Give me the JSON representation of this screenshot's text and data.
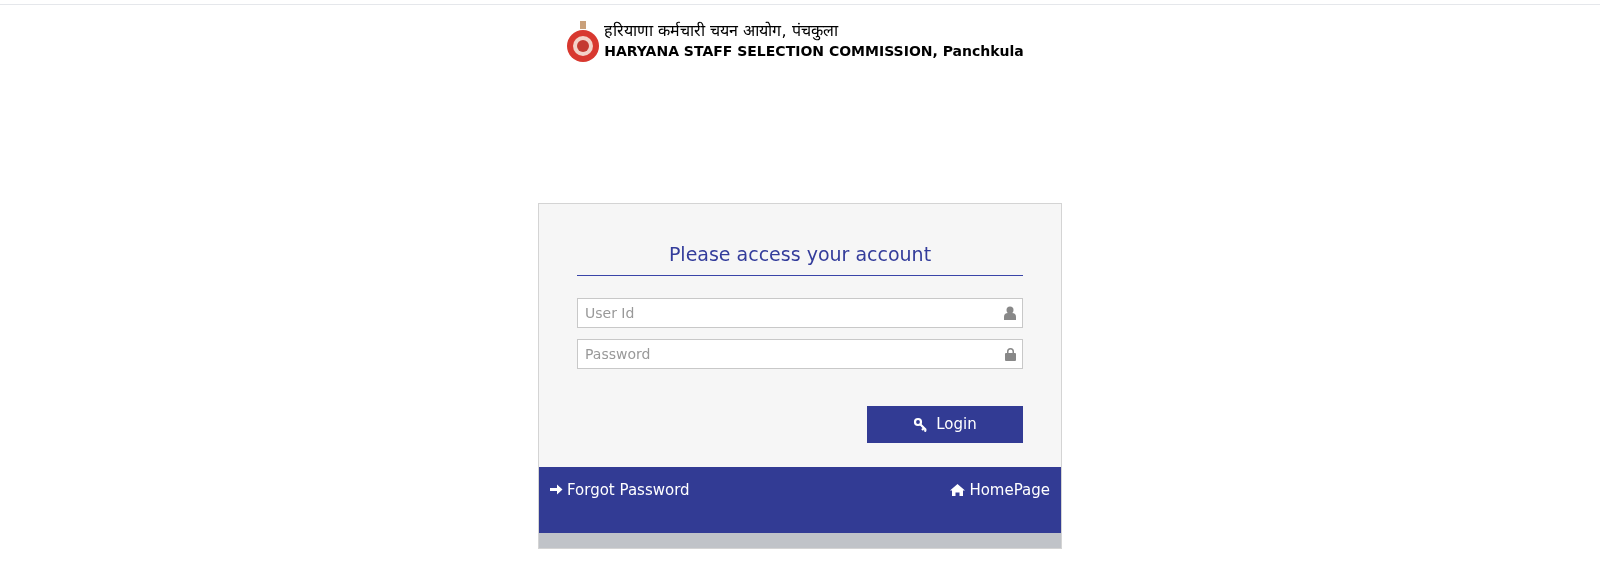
{
  "header": {
    "title_hindi": "हरियाणा कर्मचारी चयन आयोग, पंचकुला",
    "title_english": "HARYANA STAFF SELECTION COMMISSION, Panchkula"
  },
  "login": {
    "heading": "Please access your account",
    "fields": [
      {
        "kind": "user",
        "placeholder": "User Id"
      },
      {
        "kind": "password",
        "placeholder": "Password"
      }
    ],
    "button": "Login"
  },
  "footer": {
    "links": [
      {
        "kind": "forgot",
        "label": "Forgot Password"
      },
      {
        "kind": "home",
        "label": "HomePage"
      }
    ]
  }
}
